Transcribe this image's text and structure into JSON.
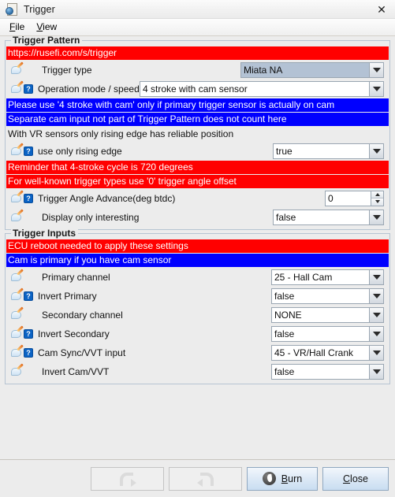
{
  "window": {
    "title": "Trigger",
    "app_icon": "settings-document-icon",
    "close_icon": "close-icon"
  },
  "menubar": {
    "items": [
      {
        "label": "File",
        "mnemonic": "F"
      },
      {
        "label": "View",
        "mnemonic": "V"
      }
    ]
  },
  "groups": [
    {
      "title": "Trigger Pattern",
      "rows": [
        {
          "kind": "banner",
          "color": "red",
          "text": "https://rusefi.com/s/trigger"
        },
        {
          "kind": "field",
          "help": false,
          "label": "Trigger type",
          "indent": true,
          "control": "combo",
          "width": "w-combo-1",
          "value": "Miata NA",
          "modified": true
        },
        {
          "kind": "field",
          "help": true,
          "label": "Operation mode / speed",
          "indent": false,
          "control": "combo",
          "width": "w-combo-2",
          "value": "4 stroke with cam sensor",
          "modified": false
        },
        {
          "kind": "banner",
          "color": "blue",
          "text": "Please use '4 stroke with cam' only if primary trigger sensor is actually on cam"
        },
        {
          "kind": "banner",
          "color": "blue",
          "text": "Separate cam input not part of Trigger Pattern does not count here"
        },
        {
          "kind": "note",
          "text": "With VR sensors only rising edge has reliable position"
        },
        {
          "kind": "field",
          "help": true,
          "label": "use only rising edge",
          "indent": false,
          "control": "combo",
          "width": "w-combo-3",
          "value": "true",
          "modified": false
        },
        {
          "kind": "banner",
          "color": "red",
          "text": "Reminder that 4-stroke cycle is 720 degrees"
        },
        {
          "kind": "banner",
          "color": "red",
          "text": "For well-known trigger types use '0' trigger angle offset"
        },
        {
          "kind": "field",
          "help": true,
          "label": "Trigger Angle Advance(deg btdc)",
          "indent": false,
          "control": "spinner",
          "value": "0"
        },
        {
          "kind": "field",
          "help": false,
          "label": "Display only interesting",
          "indent": true,
          "control": "combo",
          "width": "w-combo-3",
          "value": "false",
          "modified": false
        }
      ]
    },
    {
      "title": "Trigger Inputs",
      "rows": [
        {
          "kind": "banner",
          "color": "red",
          "text": "ECU reboot needed to apply these settings"
        },
        {
          "kind": "banner",
          "color": "blue",
          "text": "Cam is primary if you have cam sensor"
        },
        {
          "kind": "field",
          "help": false,
          "label": "Primary channel",
          "indent": true,
          "control": "combo",
          "width": "w-combo-4",
          "value": "25 - Hall Cam",
          "modified": false
        },
        {
          "kind": "field",
          "help": true,
          "label": "Invert Primary",
          "indent": false,
          "control": "combo",
          "width": "w-combo-4",
          "value": "false",
          "modified": false
        },
        {
          "kind": "field",
          "help": false,
          "label": "Secondary channel",
          "indent": true,
          "control": "combo",
          "width": "w-combo-4",
          "value": "NONE",
          "modified": false
        },
        {
          "kind": "field",
          "help": true,
          "label": "Invert Secondary",
          "indent": false,
          "control": "combo",
          "width": "w-combo-4",
          "value": "false",
          "modified": false
        },
        {
          "kind": "field",
          "help": true,
          "label": "Cam Sync/VVT input",
          "indent": false,
          "control": "combo",
          "width": "w-combo-4",
          "value": "45 - VR/Hall Crank",
          "modified": false
        },
        {
          "kind": "field",
          "help": false,
          "label": "Invert Cam/VVT",
          "indent": true,
          "control": "combo",
          "width": "w-combo-4",
          "value": "false",
          "modified": false
        }
      ]
    }
  ],
  "buttonbar": {
    "undo": {
      "icon": "undo-arrow-icon",
      "enabled": false
    },
    "redo": {
      "icon": "redo-arrow-icon",
      "enabled": false
    },
    "burn": {
      "label": "Burn",
      "mnemonic": "B",
      "icon": "burn-flame-icon"
    },
    "close": {
      "label": "Close",
      "mnemonic": "C"
    }
  },
  "colors": {
    "banner_red": "#ff0000",
    "banner_blue": "#0000ff",
    "modified_field": "#b3c2d4",
    "window_bg": "#ececec",
    "group_border": "#b6c4d2"
  }
}
